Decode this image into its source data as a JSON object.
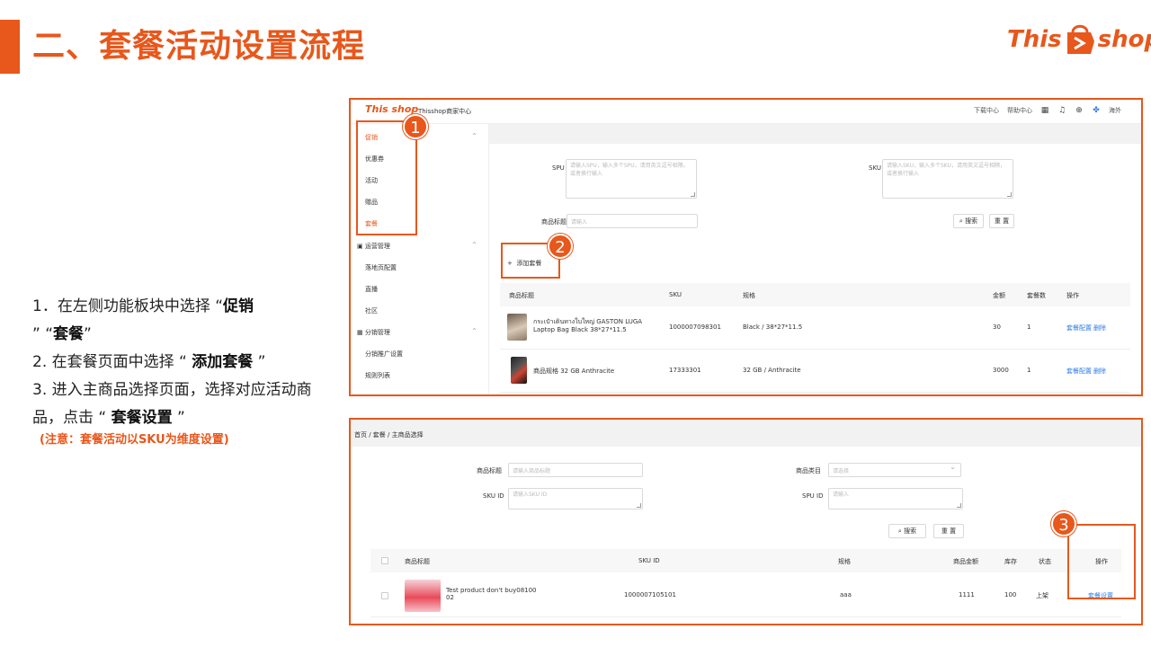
{
  "slide": {
    "title": "二、套餐活动设置流程",
    "brand_left": "This",
    "brand_right": "shop"
  },
  "instructions": {
    "step1_prefix": "1．在左侧功能板块中选择 “",
    "step1_bold_a": "促销",
    "step1_mid": "” “",
    "step1_bold_b": "套餐",
    "step1_suffix": "”",
    "step2_prefix": "2. 在套餐页面中选择 “ ",
    "step2_bold": "添加套餐",
    "step2_suffix": " ”",
    "step3_prefix": "3. 进入主商品选择页面，选择对应活动商品，点击 “ ",
    "step3_bold": "套餐设置",
    "step3_suffix": " ”",
    "note": "(注意：套餐活动以SKU为维度设置)"
  },
  "badges": [
    "1",
    "2",
    "3"
  ],
  "shot1": {
    "logo_left": "This",
    "logo_right": "shop",
    "header_title": "Thisshop商家中心",
    "top_links": [
      "下载中心",
      "帮助中心"
    ],
    "region": "海外",
    "icons": [
      "qrcode-icon",
      "bell-icon",
      "globe-icon",
      "app-grid-icon"
    ],
    "sidebar": {
      "promo_group": "促销",
      "promo_items": [
        "优惠券",
        "活动",
        "赠品",
        "套餐"
      ],
      "ops_group": "运营管理",
      "ops_items": [
        "落地页配置",
        "直播",
        "社区"
      ],
      "dist_group": "分销管理",
      "dist_items": [
        "分销推广设置",
        "规则列表"
      ]
    },
    "filters": {
      "spu_label": "SPU",
      "spu_placeholder": "请输入SPU，输入多个SPU，请用英文逗号相隔，或者换行输入",
      "sku_label": "SKU",
      "sku_placeholder": "请输入SKU，输入多个SKU，请用英文逗号相隔，或者换行输入",
      "title_label": "商品标题",
      "title_placeholder": "请输入",
      "search_btn": "搜索",
      "reset_btn": "重 置"
    },
    "add_button": "添加套餐",
    "table": {
      "headers": [
        "商品标题",
        "SKU",
        "规格",
        "金额",
        "套餐数",
        "操作"
      ],
      "rows": [
        {
          "title_line1": "กระเป๋าเดินทางใบใหญ่ GASTON LUGA",
          "title_line2": "Laptop Bag Black 38*27*11.5",
          "sku": "1000007098301",
          "spec": "Black / 38*27*11.5",
          "amount": "30",
          "count": "1",
          "action1": "套餐配置",
          "action2": "删除"
        },
        {
          "title_line1": "商品规格 32 GB Anthracite",
          "title_line2": "",
          "sku": "17333301",
          "spec": "32 GB / Anthracite",
          "amount": "3000",
          "count": "1",
          "action1": "套餐配置",
          "action2": "删除"
        }
      ]
    }
  },
  "shot2": {
    "breadcrumb": "首页  /  套餐  /  主商品选择",
    "filters": {
      "title_label": "商品标题",
      "title_placeholder": "请输入商品标题",
      "category_label": "商品类目",
      "category_placeholder": "请选择",
      "skuid_label": "SKU ID",
      "skuid_placeholder": "请输入SKU ID",
      "spuid_label": "SPU ID",
      "spuid_placeholder": "请输入",
      "search_btn": "搜索",
      "reset_btn": "重 置"
    },
    "table": {
      "headers": [
        "商品标题",
        "SKU ID",
        "规格",
        "商品金额",
        "库存",
        "状态",
        "操作"
      ],
      "row": {
        "title_line1": "Test product don't buy08100",
        "title_line2": "02",
        "sku_id": "1000007105101",
        "spec": "aaa",
        "amount": "1111",
        "stock": "100",
        "status": "上架",
        "action": "套餐设置"
      }
    }
  },
  "colors": {
    "accent": "#e8571b",
    "link": "#2d7be5"
  }
}
